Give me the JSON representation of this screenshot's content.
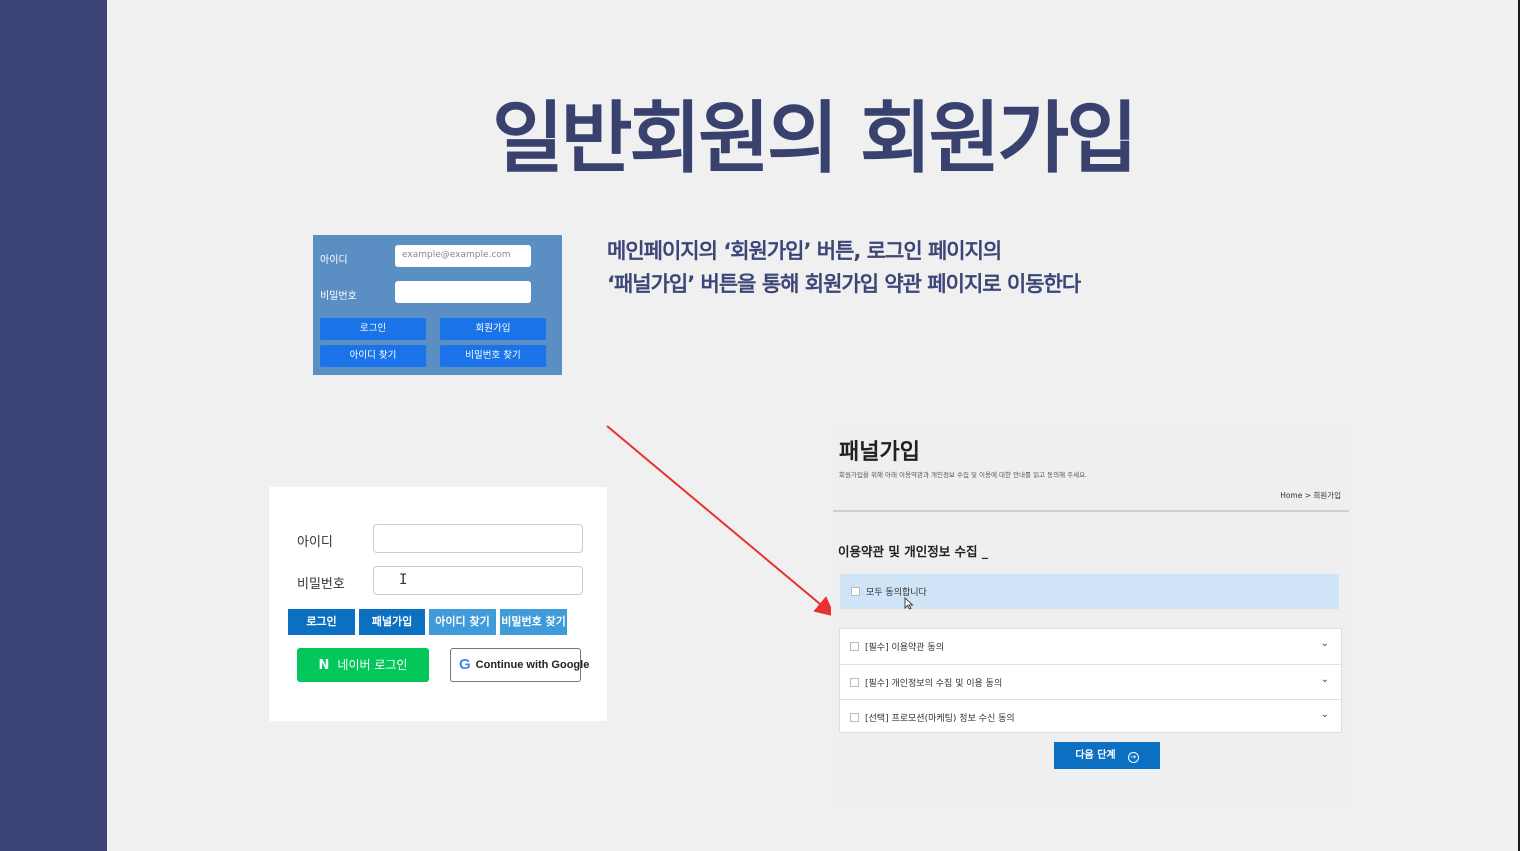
{
  "slide": {
    "title": "일반회원의 회원가입",
    "description_line1": "메인페이지의 ‘회원가입’ 버튼, 로그인 페이지의",
    "description_line2": "‘패널가입’ 버튼을 통해 회원가입 약관 페이지로 이동한다"
  },
  "colors": {
    "sidebar": "#3a4373",
    "title": "#39426f",
    "arrow": "#e8322f"
  },
  "old_login": {
    "id_label": "아이디",
    "id_placeholder": "example@example.com",
    "pw_label": "비밀번호",
    "login_btn": "로그인",
    "signup_btn": "회원가입",
    "find_id_btn": "아이디 찾기",
    "find_pw_btn": "비밀번호 찾기"
  },
  "new_login": {
    "id_label": "아이디",
    "pw_label": "비밀번호",
    "login_btn": "로그인",
    "panel_signup_btn": "패널가입",
    "find_id_btn": "아이디 찾기",
    "find_pw_btn": "비밀번호 찾기",
    "naver_btn": "네이버 로그인",
    "naver_logo": "N",
    "google_btn": "Continue with Google",
    "google_logo": "G",
    "ibeam": "I"
  },
  "panel": {
    "title": "패널가입",
    "subtitle": "회원가입을 위해 아래 이용약관과 개인정보 수집 및 이용에 대한 안내를 읽고 동의해 주세요.",
    "breadcrumb": "Home > 회원가입",
    "section_title": "이용약관 및 개인정보 수집 _",
    "agree_all": "모두 동의합니다",
    "terms": [
      "[필수] 이용약관 동의",
      "[필수] 개인정보의 수집 및 이용 동의",
      "[선택] 프로모션(마케팅) 정보 수신 동의"
    ],
    "next_btn": "다음 단계"
  }
}
